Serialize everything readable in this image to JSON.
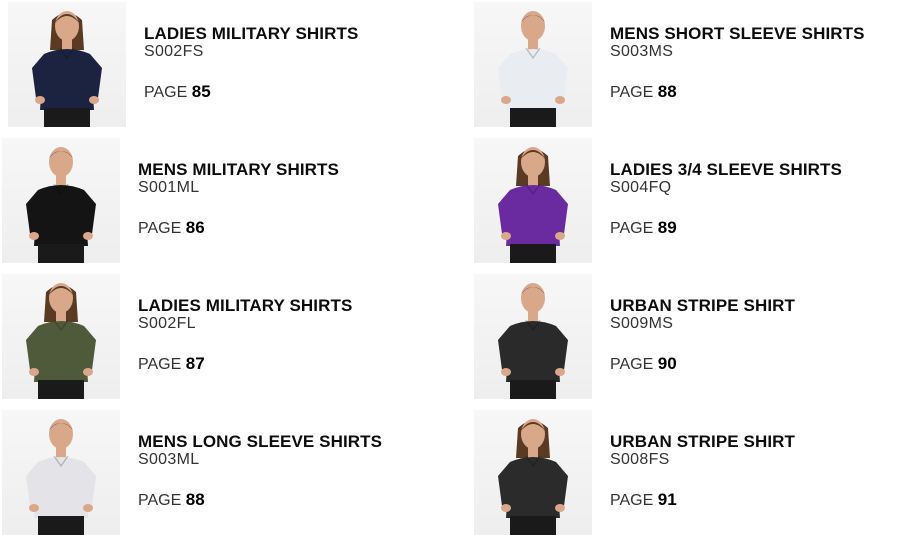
{
  "page_prefix": "PAGE",
  "items": [
    {
      "name": "LADIES MILITARY SHIRTS",
      "code": "S002FS",
      "page": "85",
      "shirt_color": "#1b2340",
      "figure": "female"
    },
    {
      "name": "MENS MILITARY SHIRTS",
      "code": "S001ML",
      "page": "86",
      "shirt_color": "#141414",
      "figure": "male"
    },
    {
      "name": "LADIES MILITARY SHIRTS",
      "code": "S002FL",
      "page": "87",
      "shirt_color": "#4e5a3a",
      "figure": "female"
    },
    {
      "name": "MENS LONG SLEEVE SHIRTS",
      "code": "S003ML",
      "page": "88",
      "shirt_color": "#e4e4e8",
      "figure": "male"
    },
    {
      "name": "MENS SHORT SLEEVE SHIRTS",
      "code": "S003MS",
      "page": "88",
      "shirt_color": "#e9edf2",
      "figure": "male"
    },
    {
      "name": "LADIES 3/4 SLEEVE SHIRTS",
      "code": "S004FQ",
      "page": "89",
      "shirt_color": "#6a2aa0",
      "figure": "female"
    },
    {
      "name": "URBAN STRIPE SHIRT",
      "code": "S009MS",
      "page": "90",
      "shirt_color": "#2a2a2a",
      "figure": "male"
    },
    {
      "name": "URBAN STRIPE SHIRT",
      "code": "S008FS",
      "page": "91",
      "shirt_color": "#2b2b2b",
      "figure": "female"
    }
  ]
}
